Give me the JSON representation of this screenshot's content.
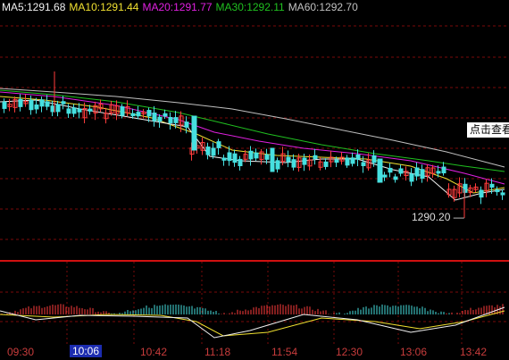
{
  "legend": {
    "ma5": "MA5:1291.68",
    "ma10": "MA10:1291.44",
    "ma20": "MA20:1291.77",
    "ma30": "MA30:1292.11",
    "ma60": "MA60:1292.70"
  },
  "colors": {
    "ma5": "#f0f0f0",
    "ma10": "#f0e030",
    "ma20": "#e020e0",
    "ma30": "#20c020",
    "ma60": "#c0c0c0",
    "up": "#ff3c3c",
    "down": "#46e0e0",
    "grid": "#7a0a0a",
    "axis_text": "#c83c3c"
  },
  "view_button": "点击查看",
  "low_marker": "1290.20 —",
  "time_labels": [
    "09:30",
    "10:06",
    "10:42",
    "11:18",
    "11:54",
    "12:30",
    "13:06",
    "13:42"
  ],
  "active_time": "10:06"
}
